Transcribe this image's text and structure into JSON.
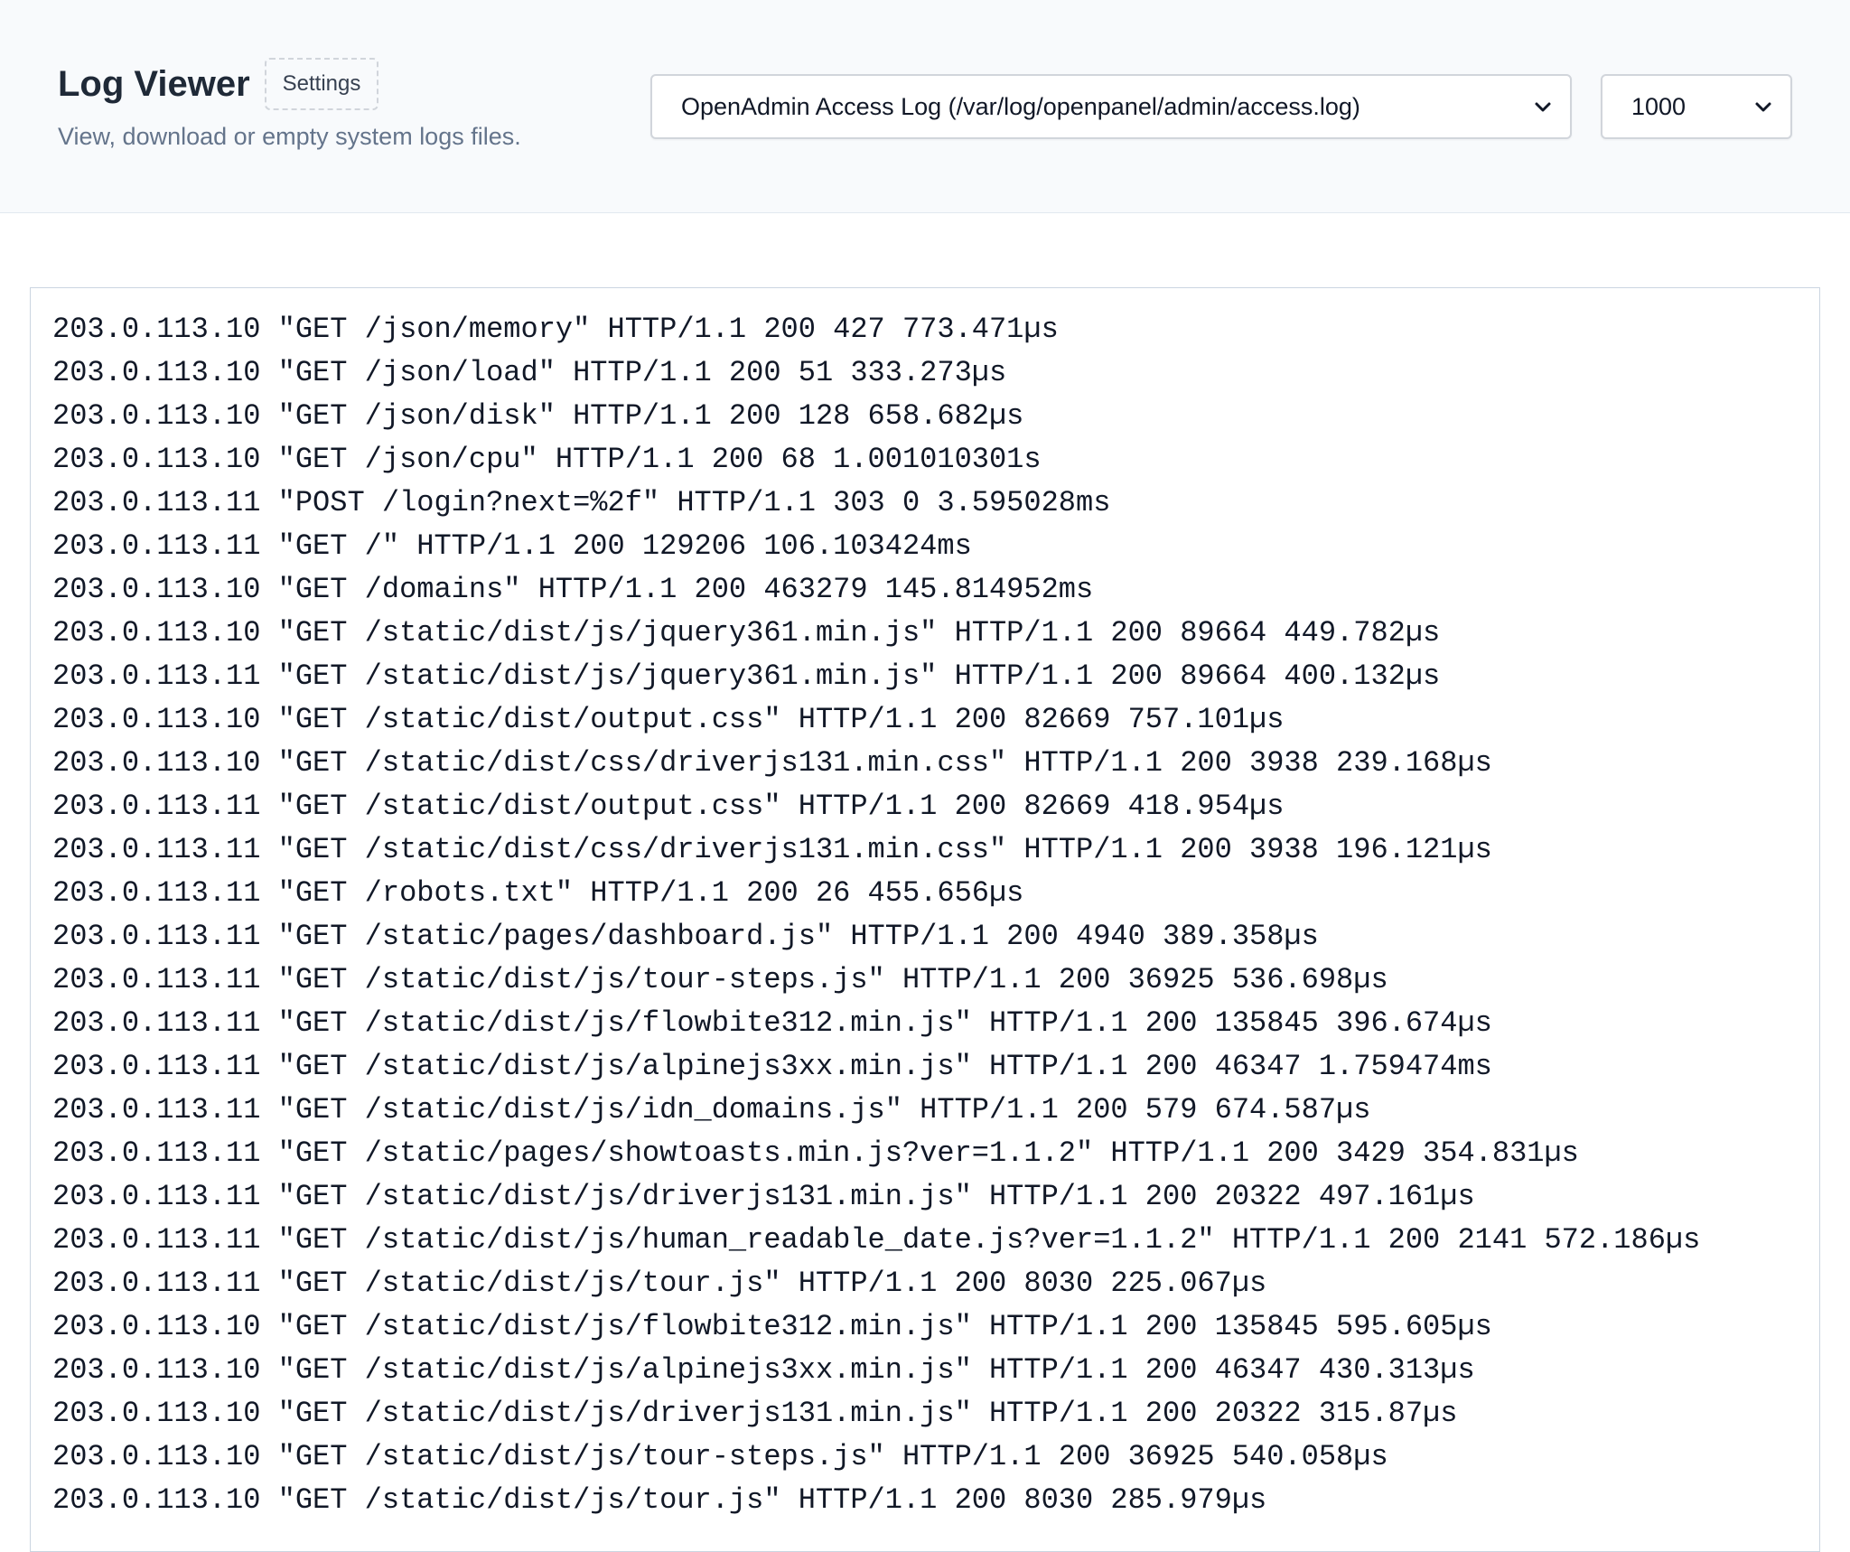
{
  "header": {
    "title": "Log Viewer",
    "settings_label": "Settings",
    "subtitle": "View, download or empty system logs files.",
    "log_select": {
      "selected": "OpenAdmin Access Log (/var/log/openpanel/admin/access.log)"
    },
    "lines_select": {
      "selected": "1000"
    }
  },
  "log": {
    "lines": [
      "203.0.113.10 \"GET /json/memory\" HTTP/1.1 200 427 773.471µs",
      "203.0.113.10 \"GET /json/load\" HTTP/1.1 200 51 333.273µs",
      "203.0.113.10 \"GET /json/disk\" HTTP/1.1 200 128 658.682µs",
      "203.0.113.10 \"GET /json/cpu\" HTTP/1.1 200 68 1.001010301s",
      "203.0.113.11 \"POST /login?next=%2f\" HTTP/1.1 303 0 3.595028ms",
      "203.0.113.11 \"GET /\" HTTP/1.1 200 129206 106.103424ms",
      "203.0.113.10 \"GET /domains\" HTTP/1.1 200 463279 145.814952ms",
      "203.0.113.10 \"GET /static/dist/js/jquery361.min.js\" HTTP/1.1 200 89664 449.782µs",
      "203.0.113.11 \"GET /static/dist/js/jquery361.min.js\" HTTP/1.1 200 89664 400.132µs",
      "203.0.113.10 \"GET /static/dist/output.css\" HTTP/1.1 200 82669 757.101µs",
      "203.0.113.10 \"GET /static/dist/css/driverjs131.min.css\" HTTP/1.1 200 3938 239.168µs",
      "203.0.113.11 \"GET /static/dist/output.css\" HTTP/1.1 200 82669 418.954µs",
      "203.0.113.11 \"GET /static/dist/css/driverjs131.min.css\" HTTP/1.1 200 3938 196.121µs",
      "203.0.113.11 \"GET /robots.txt\" HTTP/1.1 200 26 455.656µs",
      "203.0.113.11 \"GET /static/pages/dashboard.js\" HTTP/1.1 200 4940 389.358µs",
      "203.0.113.11 \"GET /static/dist/js/tour-steps.js\" HTTP/1.1 200 36925 536.698µs",
      "203.0.113.11 \"GET /static/dist/js/flowbite312.min.js\" HTTP/1.1 200 135845 396.674µs",
      "203.0.113.11 \"GET /static/dist/js/alpinejs3xx.min.js\" HTTP/1.1 200 46347 1.759474ms",
      "203.0.113.11 \"GET /static/dist/js/idn_domains.js\" HTTP/1.1 200 579 674.587µs",
      "203.0.113.11 \"GET /static/pages/showtoasts.min.js?ver=1.1.2\" HTTP/1.1 200 3429 354.831µs",
      "203.0.113.11 \"GET /static/dist/js/driverjs131.min.js\" HTTP/1.1 200 20322 497.161µs",
      "203.0.113.11 \"GET /static/dist/js/human_readable_date.js?ver=1.1.2\" HTTP/1.1 200 2141 572.186µs",
      "203.0.113.11 \"GET /static/dist/js/tour.js\" HTTP/1.1 200 8030 225.067µs",
      "203.0.113.10 \"GET /static/dist/js/flowbite312.min.js\" HTTP/1.1 200 135845 595.605µs",
      "203.0.113.10 \"GET /static/dist/js/alpinejs3xx.min.js\" HTTP/1.1 200 46347 430.313µs",
      "203.0.113.10 \"GET /static/dist/js/driverjs131.min.js\" HTTP/1.1 200 20322 315.87µs",
      "203.0.113.10 \"GET /static/dist/js/tour-steps.js\" HTTP/1.1 200 36925 540.058µs",
      "203.0.113.10 \"GET /static/dist/js/tour.js\" HTTP/1.1 200 8030 285.979µs"
    ]
  }
}
